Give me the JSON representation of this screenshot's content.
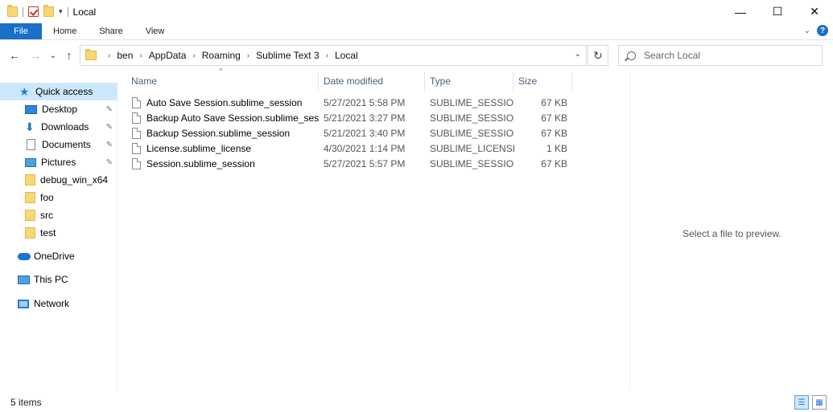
{
  "window": {
    "title": "Local",
    "minimize_glyph": "—",
    "maximize_glyph": "☐",
    "close_glyph": "✕"
  },
  "ribbon": {
    "tabs": [
      "File",
      "Home",
      "Share",
      "View"
    ],
    "help_glyph": "?",
    "collapse_glyph": "⌄"
  },
  "nav": {
    "back_glyph": "←",
    "forward_glyph": "→",
    "recent_glyph": "⌄",
    "up_glyph": "↑",
    "breadcrumbs": [
      "ben",
      "AppData",
      "Roaming",
      "Sublime Text 3",
      "Local"
    ],
    "crumb_separator": "›",
    "dropdown_glyph": "⌄",
    "refresh_glyph": "↻"
  },
  "search": {
    "placeholder": "Search Local"
  },
  "sidebar": {
    "items": [
      {
        "label": "Quick access",
        "icon": "star-icon",
        "pinned": false
      },
      {
        "label": "Desktop",
        "icon": "desktop-icon",
        "pinned": true
      },
      {
        "label": "Downloads",
        "icon": "download-arrow-icon",
        "pinned": true
      },
      {
        "label": "Documents",
        "icon": "document-icon",
        "pinned": true
      },
      {
        "label": "Pictures",
        "icon": "pictures-icon",
        "pinned": true
      },
      {
        "label": "debug_win_x64",
        "icon": "folder-icon",
        "pinned": false
      },
      {
        "label": "foo",
        "icon": "folder-icon",
        "pinned": false
      },
      {
        "label": "src",
        "icon": "folder-icon",
        "pinned": false
      },
      {
        "label": "test",
        "icon": "folder-icon",
        "pinned": false
      },
      {
        "label": "OneDrive",
        "icon": "cloud-icon",
        "pinned": false
      },
      {
        "label": "This PC",
        "icon": "computer-icon",
        "pinned": false
      },
      {
        "label": "Network",
        "icon": "network-icon",
        "pinned": false
      }
    ],
    "pin_glyph": "📌"
  },
  "columns": {
    "name": "Name",
    "date": "Date modified",
    "type": "Type",
    "size": "Size",
    "sort_glyph": "^"
  },
  "files": [
    {
      "name": "Auto Save Session.sublime_session",
      "date": "5/27/2021 5:58 PM",
      "type": "SUBLIME_SESSION...",
      "size": "67 KB"
    },
    {
      "name": "Backup Auto Save Session.sublime_session",
      "date": "5/21/2021 3:27 PM",
      "type": "SUBLIME_SESSION...",
      "size": "67 KB"
    },
    {
      "name": "Backup Session.sublime_session",
      "date": "5/21/2021 3:40 PM",
      "type": "SUBLIME_SESSION...",
      "size": "67 KB"
    },
    {
      "name": "License.sublime_license",
      "date": "4/30/2021 1:14 PM",
      "type": "SUBLIME_LICENSE...",
      "size": "1 KB"
    },
    {
      "name": "Session.sublime_session",
      "date": "5/27/2021 5:57 PM",
      "type": "SUBLIME_SESSION...",
      "size": "67 KB"
    }
  ],
  "preview": {
    "message": "Select a file to preview."
  },
  "status": {
    "item_count": "5 items"
  },
  "colors": {
    "accent": "#1a6fc9",
    "selection": "#cce8ff"
  }
}
